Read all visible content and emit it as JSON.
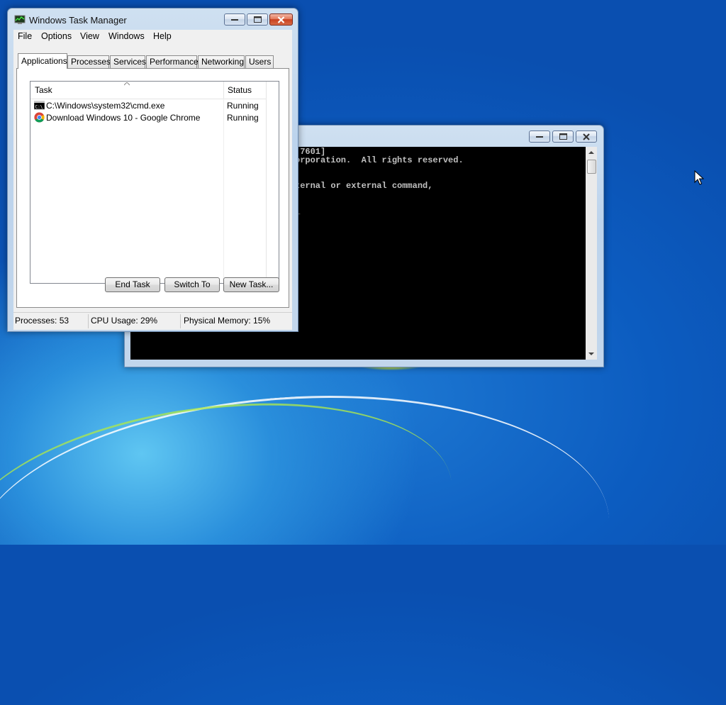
{
  "task_manager": {
    "title": "Windows Task Manager",
    "menu": [
      "File",
      "Options",
      "View",
      "Windows",
      "Help"
    ],
    "tabs": [
      "Applications",
      "Processes",
      "Services",
      "Performance",
      "Networking",
      "Users"
    ],
    "active_tab": "Applications",
    "columns": {
      "task": "Task",
      "status": "Status"
    },
    "rows": [
      {
        "task": "C:\\Windows\\system32\\cmd.exe",
        "status": "Running",
        "icon": "cmd-icon"
      },
      {
        "task": "Download Windows 10 - Google Chrome",
        "status": "Running",
        "icon": "chrome-icon"
      }
    ],
    "buttons": {
      "end_task": "End Task",
      "switch_to": "Switch To",
      "new_task": "New Task..."
    },
    "status": {
      "processes": "Processes: 53",
      "cpu": "CPU Usage: 29%",
      "memory": "Physical Memory: 15%"
    }
  },
  "cmd_window": {
    "lines": [
      ".7601]",
      "orporation.  All rights reserved.",
      "",
      "ternal or external command,",
      ".",
      ""
    ]
  },
  "colors": {
    "desktop": "#0c5fc6",
    "console_bg": "#000000",
    "console_text": "#c0c0c0",
    "close_button": "#c7401f"
  }
}
